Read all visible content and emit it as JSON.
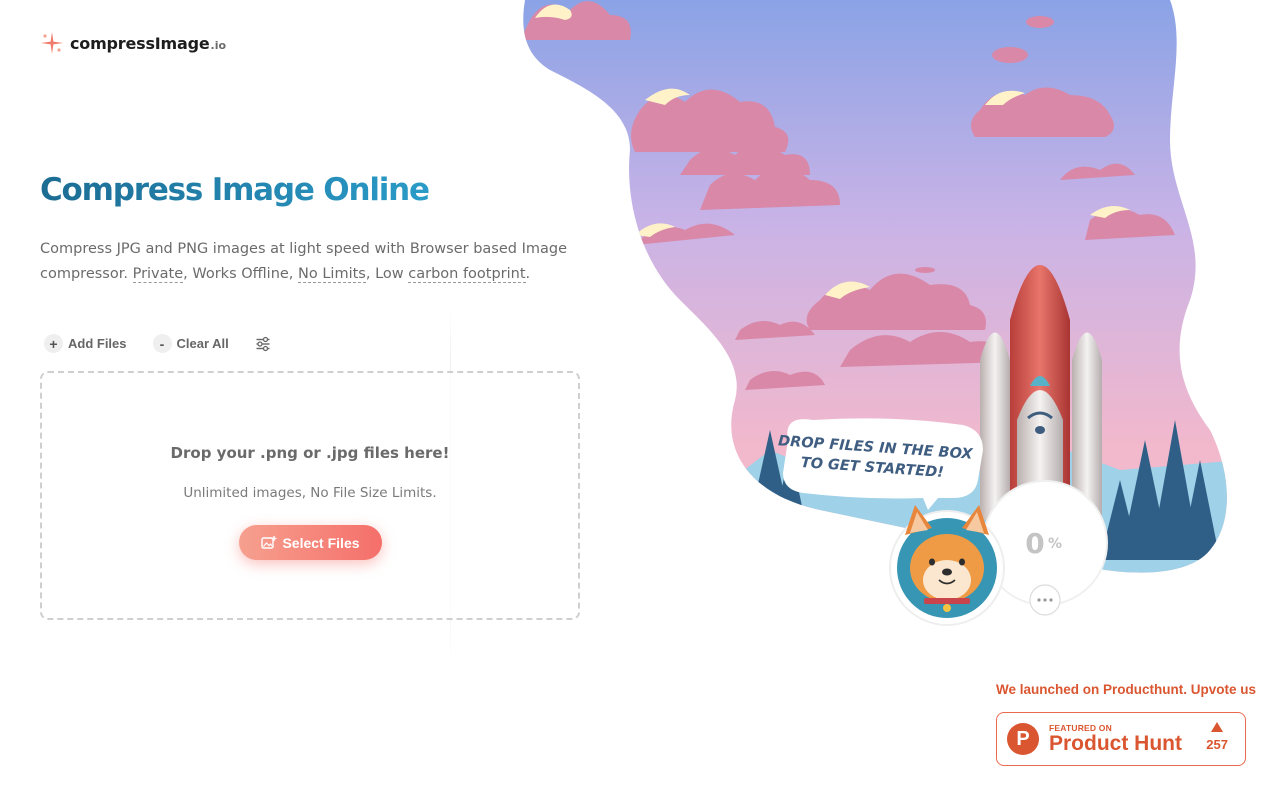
{
  "brand": {
    "name": "compressImage",
    "tld": ".io"
  },
  "hero": {
    "title": "Compress Image Online",
    "subtitle_start": "Compress JPG and PNG images at light speed with Browser based Image compressor. ",
    "private": "Private",
    "works_offline": ", Works Offline, ",
    "no_limits": "No Limits",
    "low": ", Low ",
    "carbon_footprint": "carbon footprint",
    "period": "."
  },
  "toolbar": {
    "add_icon": "+",
    "add_label": "Add Files",
    "clear_icon": "-",
    "clear_label": "Clear All",
    "settings_icon": "sliders-icon"
  },
  "dropzone": {
    "title": "Drop your .png or .jpg files here!",
    "subtitle": "Unlimited images, No File Size Limits.",
    "button_label": "Select Files"
  },
  "illustration": {
    "speech_line1": "DROP FILES IN THE BOX",
    "speech_line2": "TO GET STARTED!",
    "progress_value": "0",
    "progress_unit": "%",
    "more_icon": "more-dots-icon"
  },
  "producthunt": {
    "message": "We launched on Producthunt. Upvote us",
    "featured": "FEATURED ON",
    "name": "Product Hunt",
    "logo_letter": "P",
    "votes": "257"
  },
  "colors": {
    "title_start": "#1c6c93",
    "title_end": "#2a9bc8",
    "button_start": "#f6a08f",
    "button_end": "#f56f6a",
    "producthunt": "#da5630"
  }
}
